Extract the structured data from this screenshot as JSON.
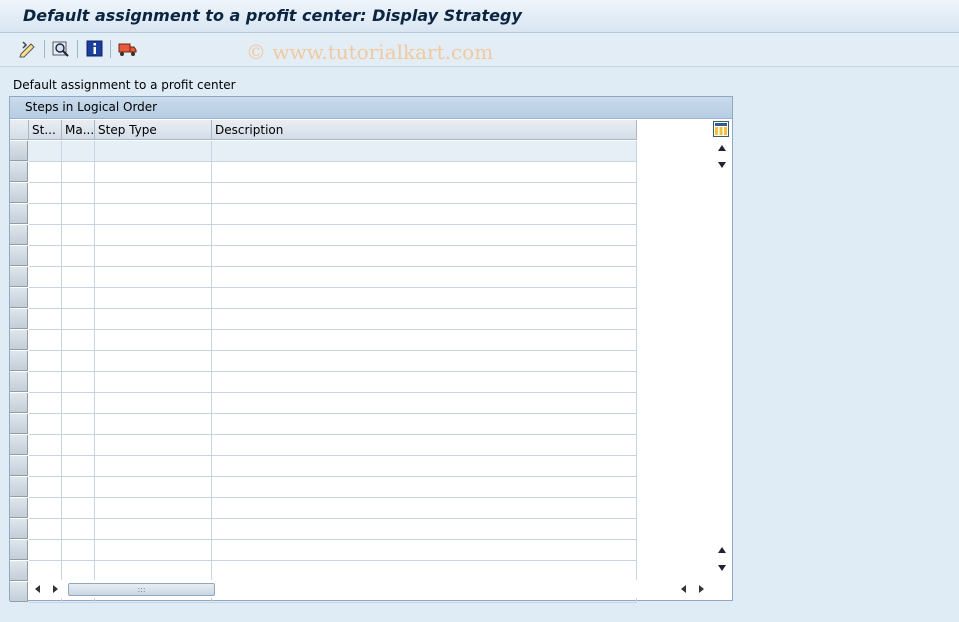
{
  "window": {
    "title": "Default assignment to a profit center: Display Strategy"
  },
  "toolbar": {
    "watermark": "© www.tutorialkart.com",
    "buttons": [
      {
        "name": "display-change-icon"
      },
      {
        "name": "find-icon"
      },
      {
        "name": "info-icon"
      },
      {
        "name": "transport-icon"
      }
    ]
  },
  "content": {
    "label": "Default assignment to a profit center"
  },
  "table": {
    "title": "Steps in Logical Order",
    "columns": [
      "St...",
      "Ma...",
      "Step Type",
      "Description"
    ],
    "rows": [
      [
        "",
        "",
        "",
        ""
      ],
      [
        "",
        "",
        "",
        ""
      ],
      [
        "",
        "",
        "",
        ""
      ],
      [
        "",
        "",
        "",
        ""
      ],
      [
        "",
        "",
        "",
        ""
      ],
      [
        "",
        "",
        "",
        ""
      ],
      [
        "",
        "",
        "",
        ""
      ],
      [
        "",
        "",
        "",
        ""
      ],
      [
        "",
        "",
        "",
        ""
      ],
      [
        "",
        "",
        "",
        ""
      ],
      [
        "",
        "",
        "",
        ""
      ],
      [
        "",
        "",
        "",
        ""
      ],
      [
        "",
        "",
        "",
        ""
      ],
      [
        "",
        "",
        "",
        ""
      ],
      [
        "",
        "",
        "",
        ""
      ],
      [
        "",
        "",
        "",
        ""
      ],
      [
        "",
        "",
        "",
        ""
      ],
      [
        "",
        "",
        "",
        ""
      ],
      [
        "",
        "",
        "",
        ""
      ],
      [
        "",
        "",
        "",
        ""
      ],
      [
        "",
        "",
        "",
        ""
      ],
      [
        "",
        "",
        "",
        ""
      ]
    ],
    "hscroll_thumb": ":::"
  },
  "colors": {
    "accent": "#0b2540",
    "panel_header": "#c9dbec",
    "background": "#dfebf5"
  }
}
